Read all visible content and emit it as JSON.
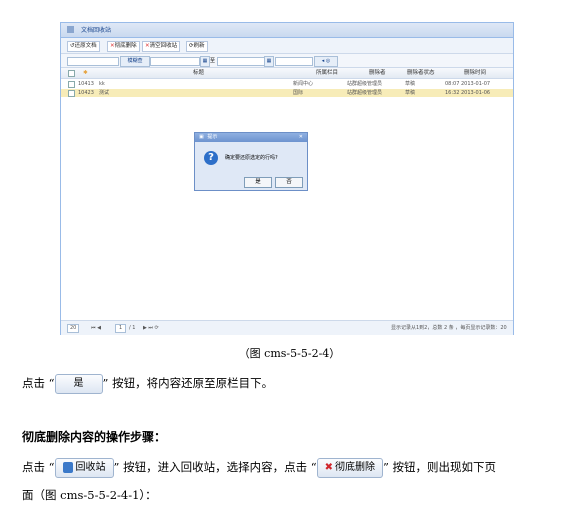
{
  "window": {
    "title": "文档回收站",
    "toolbar": {
      "restore": "还原文档",
      "delete": "彻底删除",
      "empty": "清空回收站",
      "refresh": "刷新"
    },
    "filter": {
      "search_btn": "模糊查",
      "to_label": "至"
    },
    "table": {
      "headers": [
        "标题",
        "所属栏目",
        "删除者",
        "删除者状态",
        "删除时间"
      ],
      "rows": [
        {
          "id": "10413",
          "title": "kk",
          "channel": "新闻中心",
          "deleter": "站群超级管理员",
          "status": "草稿",
          "time": "08:07 2013-01-07",
          "selected": false
        },
        {
          "id": "10423",
          "title": "测试",
          "channel": "国际",
          "deleter": "站群超级管理员",
          "status": "草稿",
          "time": "16:32 2013-01-06",
          "selected": true
        }
      ]
    },
    "pager": {
      "page_size": "20",
      "page": "1",
      "pages": "/ 1",
      "info": "显示记录从1到2，总数 2 条 ，每页显示记录数：20"
    },
    "dialog": {
      "title": "提示",
      "message": "确定要还原选定的行吗?",
      "yes": "是",
      "no": "否"
    }
  },
  "doc": {
    "caption": "（图 cms-5-5-2-4）",
    "line1_pre": "点击 “",
    "line1_btn": "是",
    "line1_post": "” 按钮，将内容还原至原栏目下。",
    "heading": "彻底删除内容的操作步骤：",
    "line2_pre": "点击 “",
    "line2_btn1": "回收站",
    "line2_mid": "” 按钮，进入回收站，选择内容，点击 “",
    "line2_btn2": "彻底删除",
    "line2_post": "” 按钮，则出现如下页",
    "line3": "面（图 cms-5-5-2-4-1）："
  }
}
